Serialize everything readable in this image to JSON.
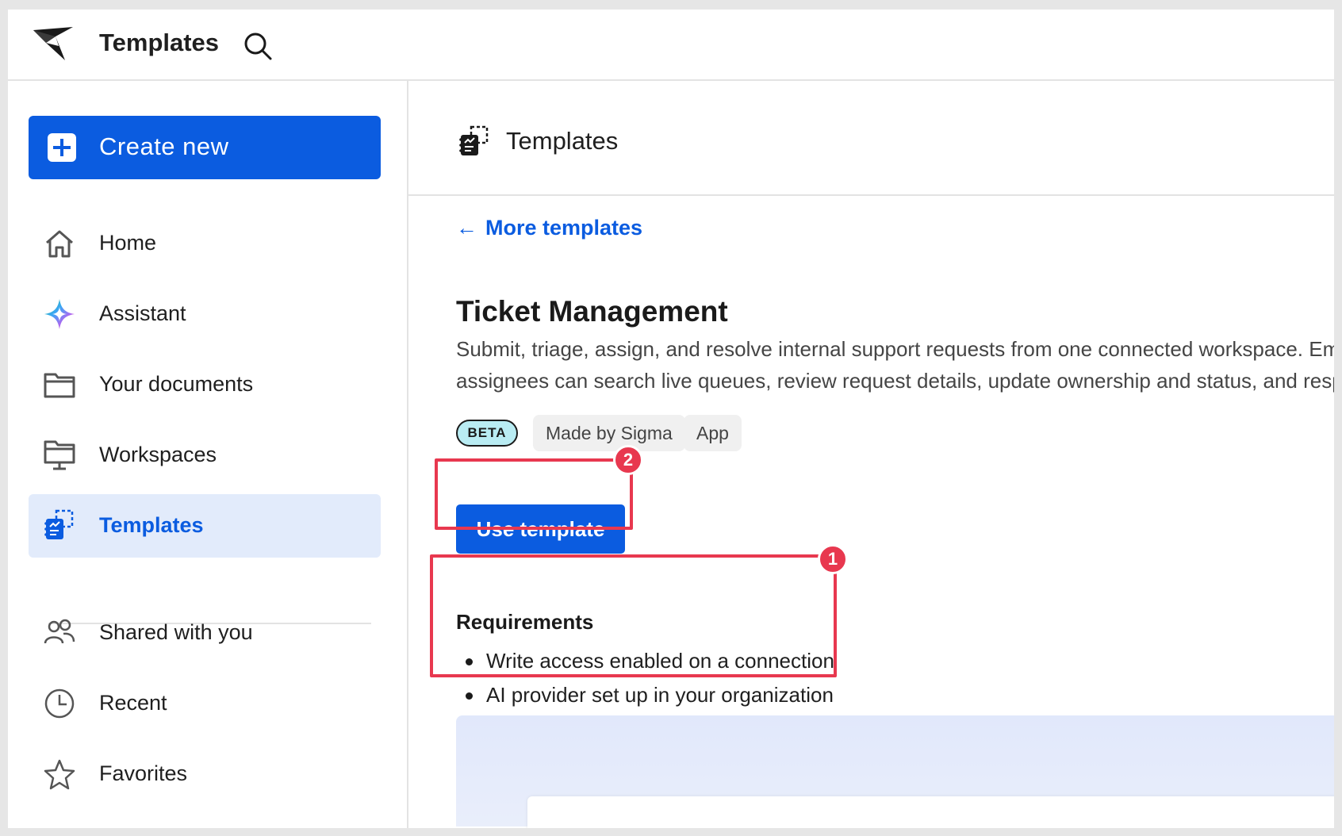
{
  "topbar": {
    "title": "Templates",
    "logo_icon": "sigma-logo-icon",
    "search_icon": "search-icon"
  },
  "sidebar": {
    "create_label": "Create new",
    "items": [
      {
        "label": "Home",
        "icon": "home-icon"
      },
      {
        "label": "Assistant",
        "icon": "assistant-sparkle-icon"
      },
      {
        "label": "Your documents",
        "icon": "folder-icon"
      },
      {
        "label": "Workspaces",
        "icon": "workspace-icon"
      },
      {
        "label": "Templates",
        "icon": "templates-icon",
        "active": true
      },
      {
        "label": "Shared with you",
        "icon": "people-icon"
      },
      {
        "label": "Recent",
        "icon": "clock-icon"
      },
      {
        "label": "Favorites",
        "icon": "star-icon"
      }
    ]
  },
  "main": {
    "header_title": "Templates",
    "back_link": "More templates",
    "back_arrow": "←",
    "template": {
      "title": "Ticket Management",
      "description_line1": "Submit, triage, assign, and resolve internal support requests from one connected workspace. Em",
      "description_line2": "assignees can search live queues, review request details, update ownership and status, and respo",
      "badges": {
        "beta": "BETA",
        "made_by": "Made by Sigma",
        "type": "App"
      },
      "use_button": "Use template",
      "requirements_title": "Requirements",
      "requirements": [
        "Write access enabled on a connection",
        "AI provider set up in your organization"
      ]
    }
  },
  "callouts": {
    "one": "1",
    "two": "2"
  },
  "colors": {
    "accent": "#0b5ce0",
    "active_bg": "#e2ebfb",
    "callout": "#e8384f",
    "beta_bg": "#b9ecf3"
  }
}
